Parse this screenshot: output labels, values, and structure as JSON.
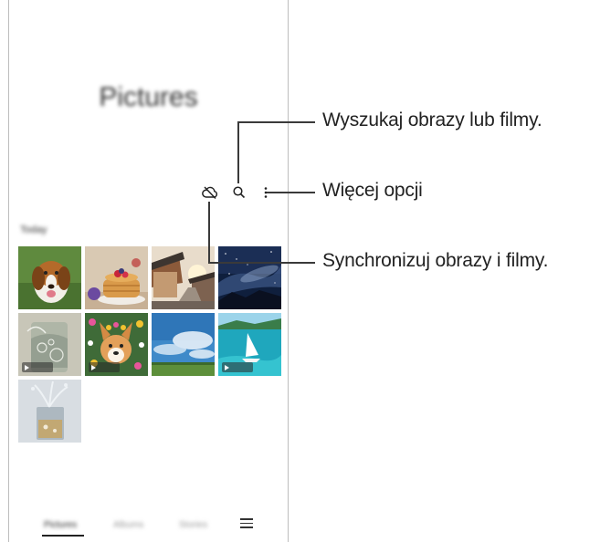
{
  "app": {
    "title": "Pictures",
    "section_label": "Today"
  },
  "toolbar": {
    "icons": [
      "cloud-sync-off-icon",
      "search-icon",
      "more-options-icon"
    ]
  },
  "thumbnails": [
    {
      "name": "beagle-photo",
      "type": "image"
    },
    {
      "name": "pancakes-photo",
      "type": "image"
    },
    {
      "name": "village-street-photo",
      "type": "image"
    },
    {
      "name": "starry-night-photo",
      "type": "image"
    },
    {
      "name": "water-glass-video",
      "type": "video"
    },
    {
      "name": "corgi-flowers-video",
      "type": "video"
    },
    {
      "name": "sky-field-photo",
      "type": "image"
    },
    {
      "name": "sailboat-video",
      "type": "video"
    },
    {
      "name": "splash-glass-photo",
      "type": "image"
    }
  ],
  "bottom_nav": {
    "tabs": [
      "Pictures",
      "Albums",
      "Stories"
    ],
    "menu_icon": "hamburger-menu-icon"
  },
  "callouts": {
    "search": "Wyszukaj obrazy lub filmy.",
    "more": "Więcej opcji",
    "sync": "Synchronizuj obrazy i filmy."
  },
  "colors": {
    "line": "#3a3a3a",
    "frame": "#bdbdbd"
  }
}
